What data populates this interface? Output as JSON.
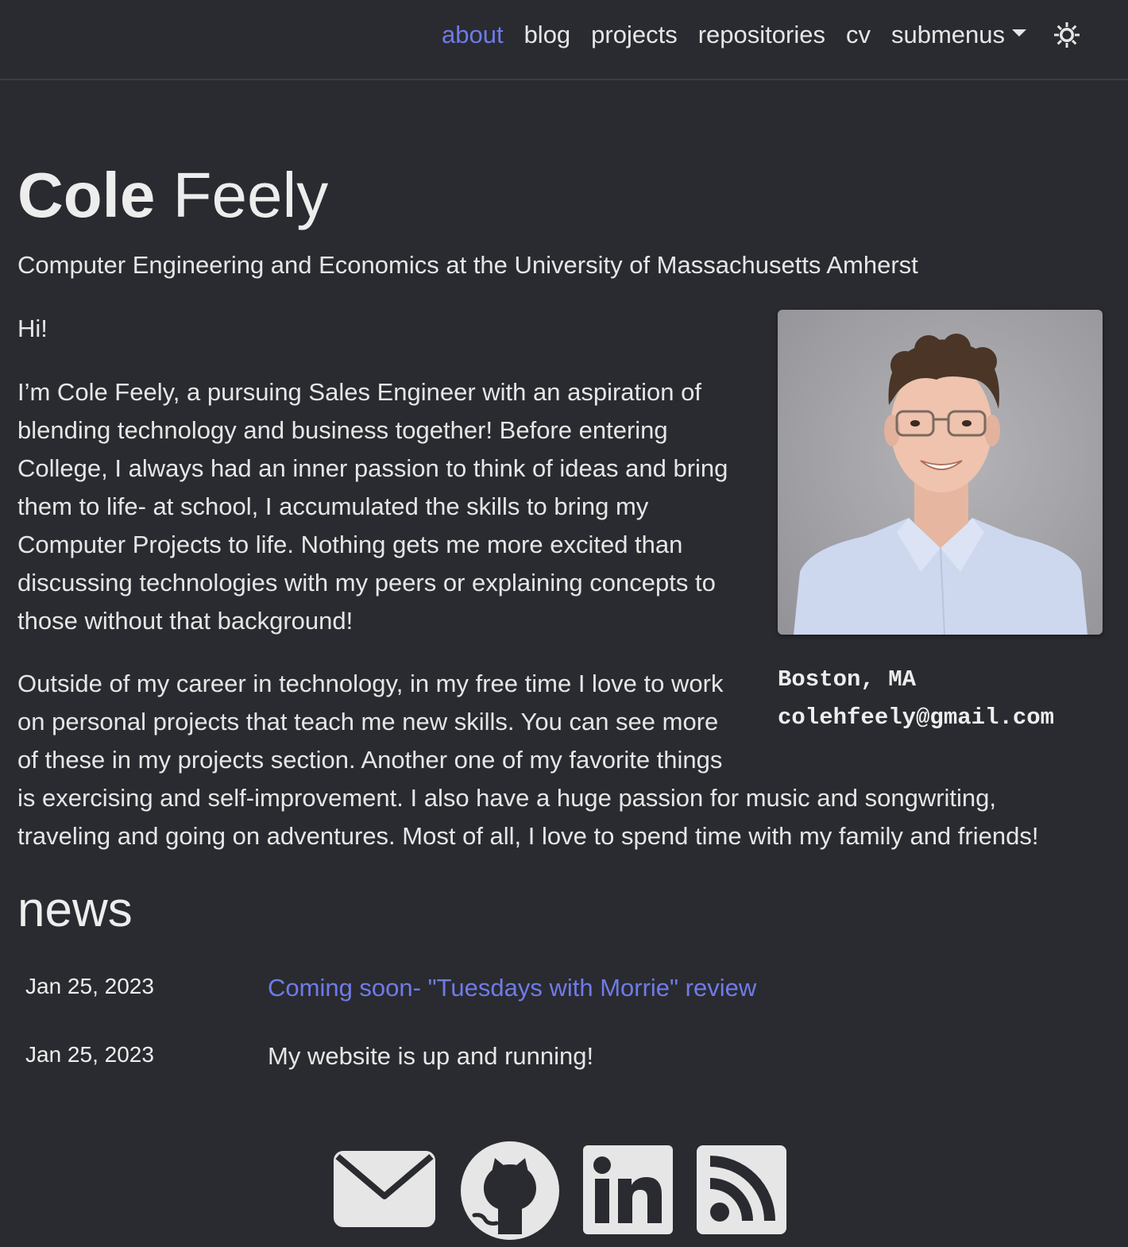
{
  "nav": {
    "items": [
      {
        "label": "about",
        "active": true
      },
      {
        "label": "blog",
        "active": false
      },
      {
        "label": "projects",
        "active": false
      },
      {
        "label": "repositories",
        "active": false
      },
      {
        "label": "cv",
        "active": false
      },
      {
        "label": "submenus",
        "active": false
      }
    ],
    "theme_icon": "sun-icon"
  },
  "header": {
    "first_name": "Cole",
    "last_name": "Feely",
    "subtitle": "Computer Engineering and Economics at the University of Massachusetts Amherst"
  },
  "profile": {
    "location": "Boston, MA",
    "email": "colehfeely@gmail.com"
  },
  "bio": {
    "greeting": "Hi!",
    "paragraph1_lines": [
      "I’m Cole Feely, a pursuing Sales Engineer with an aspiration of",
      "blending technology and business together! Before entering",
      "College, I always had an inner passion to think of ideas and bring",
      "them to life- at school, I accumulated the skills to bring my",
      "Computer Projects to life. Nothing gets me more excited than",
      "discussing technologies with my peers or explaining concepts to",
      "those without that background!"
    ],
    "paragraph2_lines": [
      "Outside of my career in technology, in my free time I love to work",
      "on personal projects that teach me new skills. You can see more",
      "of these in my projects section. Another one of my favorite things",
      "is exercising and self-improvement. I also have a huge passion for music and songwriting,",
      "traveling and going on adventures. Most of all, I love to spend time with my family and friends!"
    ]
  },
  "news": {
    "title": "news",
    "items": [
      {
        "date": "Jan 25, 2023",
        "text": "Coming soon- \"Tuesdays with Morrie\" review",
        "is_link": true
      },
      {
        "date": "Jan 25, 2023",
        "text": "My website is up and running!",
        "is_link": false
      }
    ]
  },
  "social": {
    "icons": [
      "envelope-icon",
      "github-icon",
      "linkedin-icon",
      "rss-icon"
    ]
  },
  "colors": {
    "background": "#2a2b30",
    "text": "#e6e6e6",
    "accent": "#6f7be8"
  }
}
